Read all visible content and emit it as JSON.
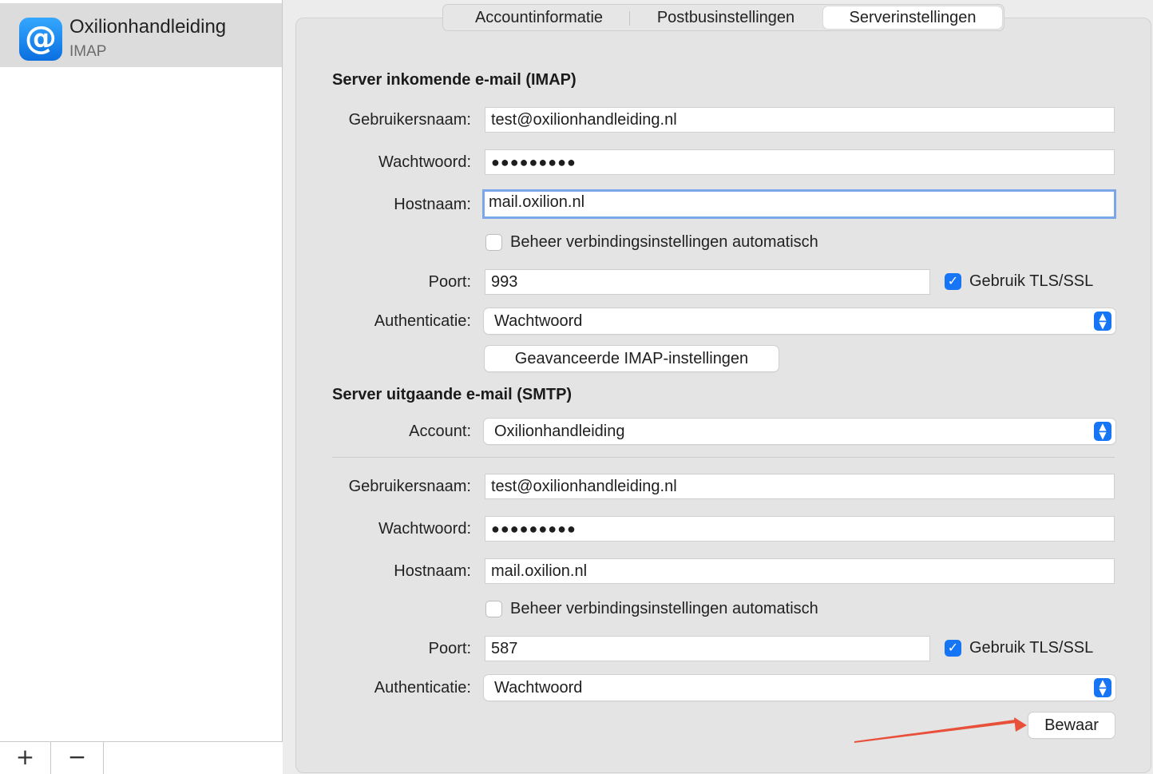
{
  "sidebar": {
    "account_name": "Oxilionhandleiding",
    "account_type": "IMAP",
    "add_label": "+",
    "remove_label": "−"
  },
  "tabs": {
    "account_info": "Accountinformatie",
    "mailbox_settings": "Postbusinstellingen",
    "server_settings": "Serverinstellingen"
  },
  "incoming": {
    "title": "Server inkomende e-mail (IMAP)",
    "username_label": "Gebruikersnaam:",
    "username": "test@oxilionhandleiding.nl",
    "password_label": "Wachtwoord:",
    "password": "●●●●●●●●●",
    "hostname_label": "Hostnaam:",
    "hostname": "mail.oxilion.nl",
    "auto_manage_label": "Beheer verbindingsinstellingen automatisch",
    "port_label": "Poort:",
    "port": "993",
    "tls_label": "Gebruik TLS/SSL",
    "auth_label": "Authenticatie:",
    "auth_value": "Wachtwoord",
    "advanced_button": "Geavanceerde IMAP-instellingen"
  },
  "outgoing": {
    "title": "Server uitgaande e-mail (SMTP)",
    "account_label": "Account:",
    "account_value": "Oxilionhandleiding",
    "username_label": "Gebruikersnaam:",
    "username": "test@oxilionhandleiding.nl",
    "password_label": "Wachtwoord:",
    "password": "●●●●●●●●●",
    "hostname_label": "Hostnaam:",
    "hostname": "mail.oxilion.nl",
    "auto_manage_label": "Beheer verbindingsinstellingen automatisch",
    "port_label": "Poort:",
    "port": "587",
    "tls_label": "Gebruik TLS/SSL",
    "auth_label": "Authenticatie:",
    "auth_value": "Wachtwoord"
  },
  "save_button": "Bewaar",
  "colors": {
    "accent": "#1575f5",
    "annotation_arrow": "#e8503a",
    "focus_ring": "#7ba7ea"
  }
}
